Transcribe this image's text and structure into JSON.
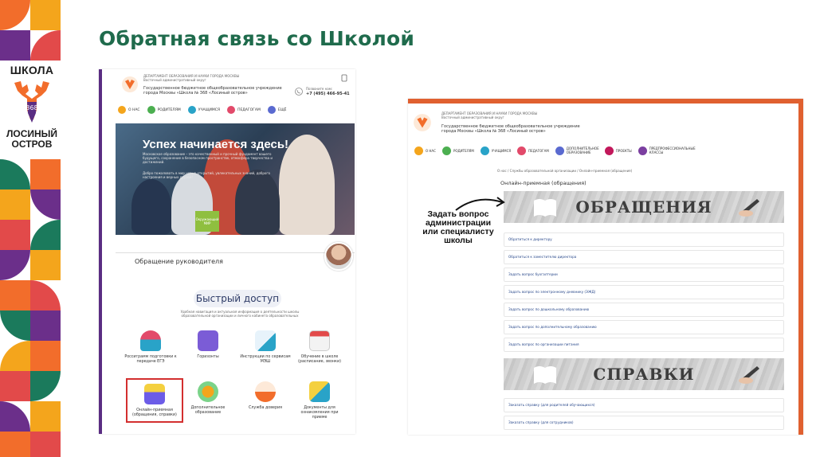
{
  "slide_title": "Обратная связь со Школой",
  "logo": {
    "line1": "ШКОЛА",
    "number": "368",
    "line2": "ЛОСИНЫЙ",
    "line3": "ОСТРОВ"
  },
  "left_site": {
    "dept_line": "ДЕПАРТАМЕНТ ОБРАЗОВАНИЯ И НАУКИ ГОРОДА МОСКВЫ",
    "district_line": "Восточный административный округ",
    "school_name": "Государственное бюджетное общеобразовательное учреждение города Москвы «Школа № 368 «Лосиный остров»",
    "call_label": "Позвоните нам:",
    "phone": "+7 (495) 466-95-41",
    "nav": [
      "О НАС",
      "РОДИТЕЛЯМ",
      "УЧАЩИМСЯ",
      "ПЕДАГОГАМ",
      "ЕЩЁ"
    ],
    "hero_title": "Успех начинается здесь!",
    "hero_text": "Московское образование – это качественный и прочный фундамент вашего будущего, сохранение в безопасном пространстве, атмосфера творчества и достижений.",
    "hero_text2": "Добро пожаловать в мир новых открытий, увлекательных знаний, доброго настроения и верных друзей!",
    "book_label": "Окружающий МИР",
    "director_label": "Обращение руководителя",
    "quick_access": "Быстрый доступ",
    "quick_desc": "Удобная навигация и актуальная информация о деятельности школы образовательной организации и личного кабинета образовательных",
    "tiles": [
      {
        "label": "Россиграмм подготовки к передаче ЕГЭ"
      },
      {
        "label": "Горизонты"
      },
      {
        "label": "Инструкции по сервисам МЭШ"
      },
      {
        "label": "Обучение в школе (расписание, звонки)"
      },
      {
        "label": "Онлайн-приемная (обращения, справки)"
      },
      {
        "label": "Дополнительное образование"
      },
      {
        "label": "Служба доверия"
      },
      {
        "label": "Документы для ознакомления при приеме"
      }
    ]
  },
  "right_site": {
    "dept_line": "ДЕПАРТАМЕНТ ОБРАЗОВАНИЯ И НАУКИ ГОРОДА МОСКВЫ",
    "district_line": "Восточный административный округ",
    "school_name": "Государственное бюджетное общеобразовательное учреждение города Москвы «Школа № 368 «Лосиный остров»",
    "nav": [
      "О НАС",
      "РОДИТЕЛЯМ",
      "УЧАЩИМСЯ",
      "ПЕДАГОГАМ",
      "ДОПОЛНИТЕЛЬНОЕ ОБРАЗОВАНИЕ",
      "ПРОЕКТЫ",
      "ПРЕДПРОФЕССИОНАЛЬНЫЕ КЛАССЫ"
    ],
    "breadcrumb": "О нас  /  Службы образовательной организации  /  Онлайн-приемная (обращения)",
    "page_title": "Онлайн-приемная (обращения)",
    "banner_requests": "ОБРАЩЕНИЯ",
    "requests": [
      "Обратиться к директору",
      "Обратиться к заместителю директора",
      "Задать вопрос бухгалтерии",
      "Задать вопрос по электронному дневнику (ЭЖД)",
      "Задать вопрос по дошкольному образованию",
      "Задать вопрос по дополнительному образованию",
      "Задать вопрос по организации питания"
    ],
    "banner_certificates": "СПРАВКИ",
    "certificates": [
      "Заказать справку (для родителей обучающихся)",
      "Заказать справку (для сотрудников)"
    ]
  },
  "callout": "Задать вопрос администрации или специалисту школы",
  "colors": {
    "title_green": "#1f6b4c",
    "left_border": "#5a2d82",
    "right_border": "#e06030",
    "highlight_red": "#d32f2f"
  }
}
